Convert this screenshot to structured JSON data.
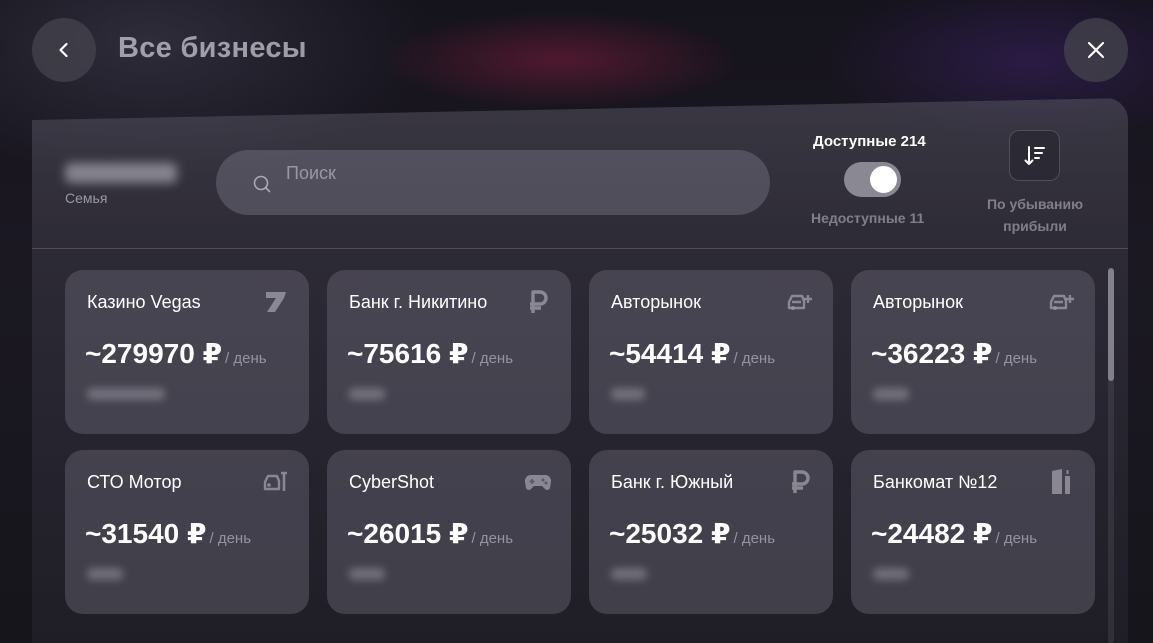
{
  "header": {
    "title": "Все бизнесы",
    "back_icon": "chevron-left-icon",
    "close_icon": "close-icon"
  },
  "filter_bar": {
    "family_label": "Семья",
    "search_placeholder": "Поиск",
    "available_label": "Доступные 214",
    "toggle_on": true,
    "unavailable_label": "Недоступные 11",
    "sort_label": "По убыванию прибыли"
  },
  "businesses": [
    {
      "name": "Казино Vegas",
      "amount": "~279970 ₽",
      "per": "/ день",
      "icon": "casino-seven-icon"
    },
    {
      "name": "Банк г. Никитино",
      "amount": "~75616 ₽",
      "per": "/ день",
      "icon": "ruble-icon"
    },
    {
      "name": "Авторынок",
      "amount": "~54414 ₽",
      "per": "/ день",
      "icon": "car-plus-icon"
    },
    {
      "name": "Авторынок",
      "amount": "~36223 ₽",
      "per": "/ день",
      "icon": "car-plus-icon"
    },
    {
      "name": "СТО Мотор",
      "amount": "~31540 ₽",
      "per": "/ день",
      "icon": "car-wrench-icon"
    },
    {
      "name": "CyberShot",
      "amount": "~26015 ₽",
      "per": "/ день",
      "icon": "gamepad-icon"
    },
    {
      "name": "Банк г. Южный",
      "amount": "~25032 ₽",
      "per": "/ день",
      "icon": "ruble-icon"
    },
    {
      "name": "Банкомат №12",
      "amount": "~24482 ₽",
      "per": "/ день",
      "icon": "atm-icon"
    }
  ],
  "colors": {
    "background": "#17151d",
    "card": "#5c5a68",
    "toggle": "#8a8892"
  }
}
